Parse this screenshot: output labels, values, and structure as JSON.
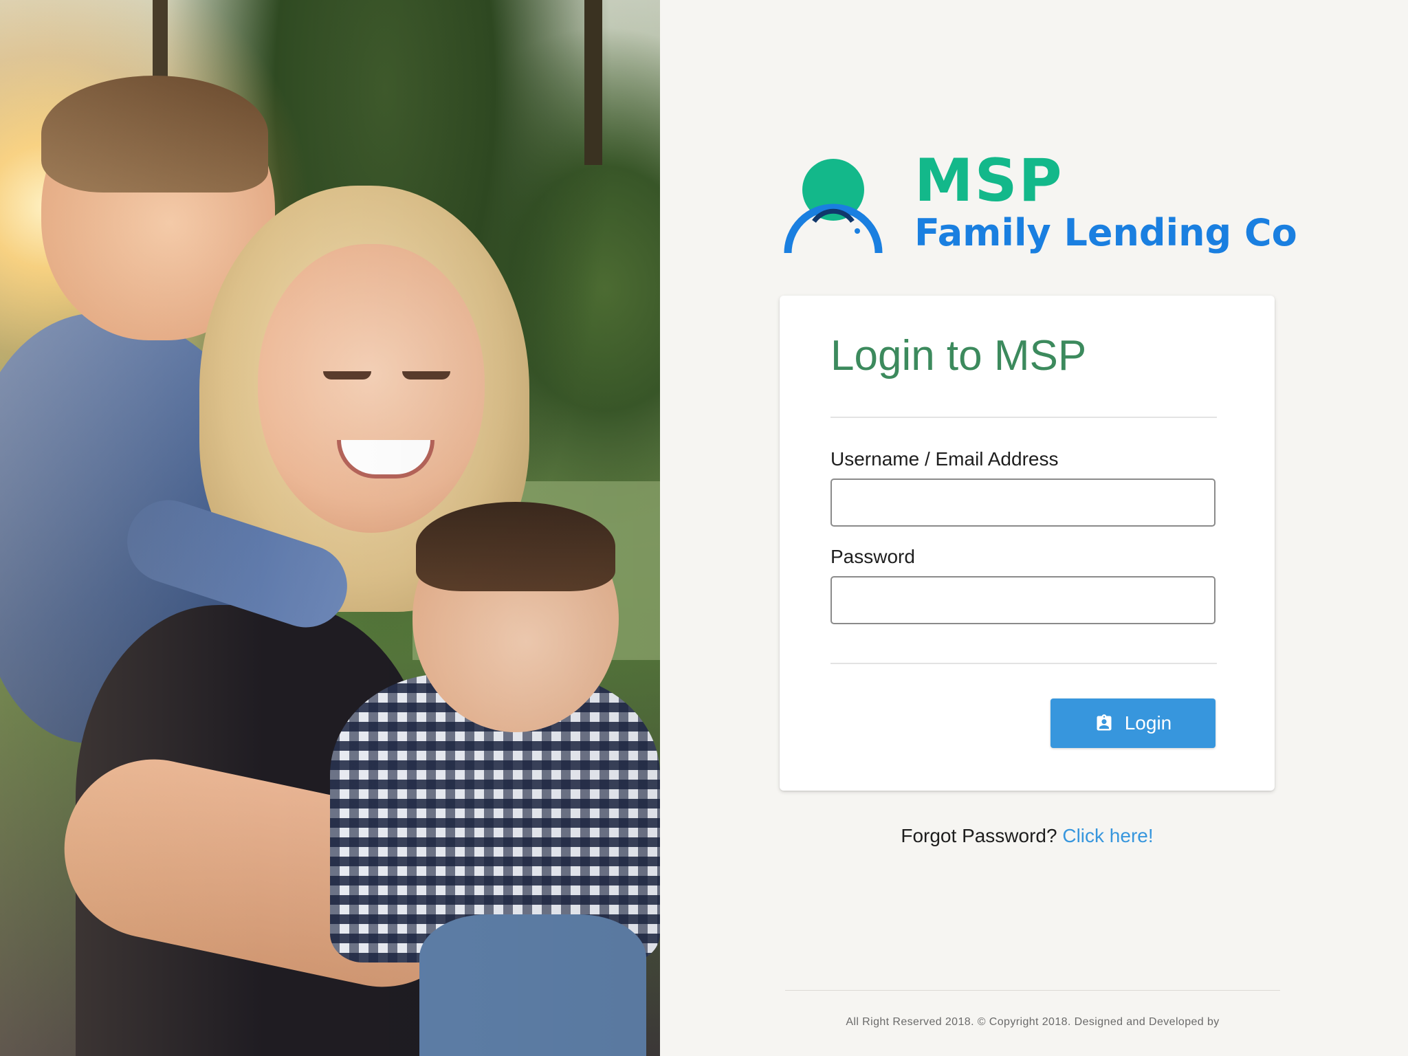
{
  "brand": {
    "name": "MSP",
    "subtitle": "Family Lending Co",
    "colors": {
      "name": "#13b88a",
      "subtitle": "#1a7fe0",
      "logo_head": "#13b88a",
      "logo_arc": "#1a7fe0",
      "logo_arc_dark": "#10376b"
    },
    "logo_icon": "person-arc-logo"
  },
  "hero_image": {
    "subject": "family-photo"
  },
  "login_card": {
    "title": "Login to MSP",
    "username_label": "Username / Email Address",
    "username_value": "",
    "username_placeholder": "",
    "password_label": "Password",
    "password_value": "",
    "password_placeholder": "",
    "login_button_label": "Login",
    "login_button_icon": "account-box-icon",
    "accent_color": "#3796dd",
    "title_color": "#3c8a5d"
  },
  "forgot": {
    "text": "Forgot Password?",
    "link_label": "Click here!"
  },
  "footer": {
    "text": "All Right Reserved 2018. © Copyright 2018. Designed and Developed by"
  }
}
